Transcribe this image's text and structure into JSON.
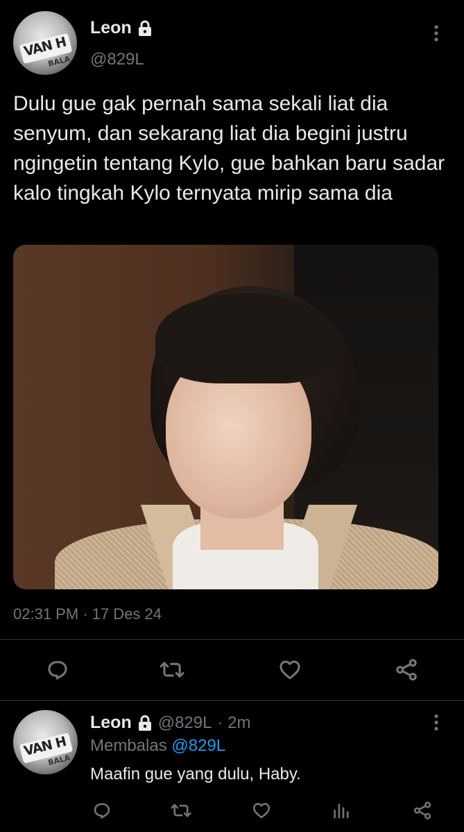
{
  "main_tweet": {
    "author_name": "Leon",
    "author_handle": "@829L",
    "text": "Dulu gue gak pernah sama sekali liat dia senyum, dan sekarang liat dia begini justru ngingetin tentang Kylo, gue bahkan baru sadar kalo tingkah Kylo ternyata mirip sama dia",
    "timestamp": "02:31 PM · 17 Des 24",
    "avatar_text": [
      "VAN H",
      "BALA"
    ]
  },
  "reply": {
    "author_name": "Leon",
    "author_handle": "@829L",
    "age": "· 2m",
    "replying_to_label": "Membalas",
    "replying_to_handle": "@829L",
    "text": "Maafin gue yang dulu, Haby."
  },
  "colors": {
    "background": "#000000",
    "text": "#e7e9ea",
    "muted": "#71767b",
    "link": "#1d9bf0",
    "divider": "#2f3336"
  },
  "icons": {
    "main_actions": [
      "reply-icon",
      "retweet-icon",
      "like-icon",
      "share-icon"
    ],
    "reply_actions": [
      "reply-icon",
      "retweet-icon",
      "like-icon",
      "views-icon",
      "share-icon"
    ],
    "menu": "more-vertical-icon",
    "protected": "lock-icon"
  }
}
